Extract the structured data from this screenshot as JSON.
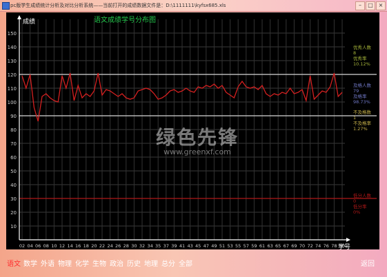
{
  "window": {
    "title": "pc版学生成绩统计分析及对比分析系统——当前打开的成绩数据文件是：D:\\1111111\\kyfsx685.xls",
    "min": "–",
    "max": "□",
    "close": "×"
  },
  "chart_data": {
    "type": "line",
    "title": "语文成绩学号分布图",
    "ylabel": "成绩",
    "xlabel": "学号",
    "ylim": [
      0,
      160
    ],
    "y_ticks": [
      10,
      20,
      30,
      40,
      50,
      60,
      70,
      80,
      90,
      100,
      110,
      120,
      130,
      140,
      150
    ],
    "x_ticks": [
      "02",
      "04",
      "06",
      "08",
      "10",
      "12",
      "14",
      "16",
      "18",
      "20",
      "22",
      "24",
      "26",
      "28",
      "30",
      "32",
      "34",
      "35",
      "37",
      "39",
      "41",
      "43",
      "45",
      "47",
      "49",
      "51",
      "53",
      "55",
      "57",
      "59",
      "61",
      "63",
      "65",
      "67",
      "69",
      "70",
      "72",
      "74",
      "76",
      "78",
      "80"
    ],
    "x": [
      1,
      2,
      3,
      4,
      5,
      6,
      7,
      8,
      9,
      10,
      11,
      12,
      13,
      14,
      15,
      16,
      17,
      18,
      19,
      20,
      21,
      22,
      23,
      24,
      25,
      26,
      27,
      28,
      29,
      30,
      31,
      32,
      33,
      34,
      35,
      36,
      37,
      38,
      39,
      40,
      41,
      42,
      43,
      44,
      45,
      46,
      47,
      48,
      49,
      50,
      51,
      52,
      53,
      54,
      55,
      56,
      57,
      58,
      59,
      60,
      61,
      62,
      63,
      64,
      65,
      66,
      67,
      68,
      69,
      70,
      71,
      72,
      73,
      74,
      75,
      76,
      77,
      78,
      79,
      80,
      81
    ],
    "series": [
      {
        "values": [
          119,
          110,
          120,
          96,
          86,
          104,
          106,
          103,
          101,
          100,
          119,
          110,
          121,
          101,
          112,
          103,
          106,
          104,
          108,
          121,
          105,
          109,
          108,
          106,
          104,
          106,
          103,
          102,
          103,
          108,
          109,
          110,
          109,
          106,
          102,
          103,
          105,
          108,
          109,
          107,
          108,
          110,
          108,
          107,
          111,
          110,
          112,
          111,
          113,
          110,
          112,
          107,
          105,
          103,
          111,
          115,
          111,
          110,
          111,
          109,
          112,
          106,
          104,
          106,
          105,
          107,
          106,
          110,
          106,
          107,
          109,
          101,
          119,
          102,
          105,
          108,
          107,
          111,
          121,
          104,
          107
        ],
        "color": "#d42020"
      }
    ],
    "reference_lines": [
      {
        "value": 120,
        "color": "#d8d8d8"
      },
      {
        "value": 90,
        "color": "#d8d8d8"
      },
      {
        "value": 30,
        "color": "#b01818"
      }
    ],
    "side_stats": [
      {
        "label": "优秀人数",
        "count": "8",
        "rate_label": "优秀率",
        "rate": "10.12%",
        "color": "#a6b53a"
      },
      {
        "label": "及格人数",
        "count": "79",
        "rate_label": "及格率",
        "rate": "98.73%",
        "color": "#6f77c4"
      },
      {
        "label": "不及格数",
        "count": "1",
        "rate_label": "不及格率",
        "rate": "1.27%",
        "color": "#c8b24a"
      },
      {
        "label": "低分人数",
        "count": "0",
        "rate_label": "低分率",
        "rate": "0%",
        "color": "#b01818"
      }
    ]
  },
  "tabs": [
    "语文",
    "数学",
    "外语",
    "物理",
    "化学",
    "生物",
    "政治",
    "历史",
    "地理",
    "总分",
    "全部"
  ],
  "active_tab": 0,
  "back_label": "返回",
  "watermark": {
    "logo": "绿色先锋",
    "url": "www.greenxf.com"
  }
}
